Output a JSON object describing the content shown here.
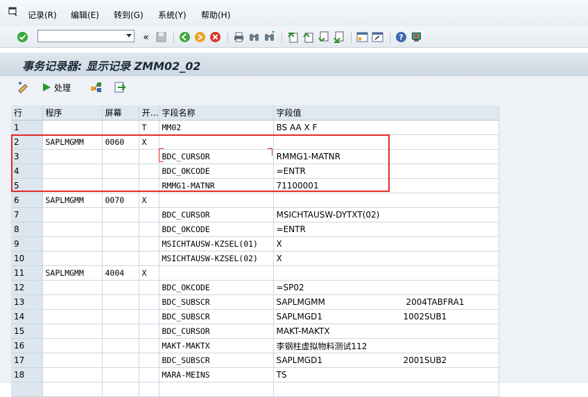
{
  "menu": [
    {
      "label": "记录(R)"
    },
    {
      "label": "编辑(E)"
    },
    {
      "label": "转到(G)"
    },
    {
      "label": "系统(Y)"
    },
    {
      "label": "帮助(H)"
    }
  ],
  "command_field": {
    "value": ""
  },
  "title": "事务记录器: 显示记录 ZMM02_02",
  "app_toolbar": {
    "process_label": "处理"
  },
  "table": {
    "headers": [
      "行",
      "程序",
      "屏幕",
      "开…",
      "字段名称",
      "字段值"
    ],
    "rows": [
      {
        "no": "1",
        "program": "",
        "screen": "",
        "start": "T",
        "field": "MM02",
        "value": "BS AA X   F",
        "value2": ""
      },
      {
        "no": "2",
        "program": "SAPLMGMM",
        "screen": "0060",
        "start": "X",
        "field": "",
        "value": "",
        "value2": ""
      },
      {
        "no": "3",
        "program": "",
        "screen": "",
        "start": "",
        "field": "BDC_CURSOR",
        "value": "RMMG1-MATNR",
        "value2": ""
      },
      {
        "no": "4",
        "program": "",
        "screen": "",
        "start": "",
        "field": "BDC_OKCODE",
        "value": "=ENTR",
        "value2": ""
      },
      {
        "no": "5",
        "program": "",
        "screen": "",
        "start": "",
        "field": "RMMG1-MATNR",
        "value": "71100001",
        "value2": ""
      },
      {
        "no": "6",
        "program": "SAPLMGMM",
        "screen": "0070",
        "start": "X",
        "field": "",
        "value": "",
        "value2": ""
      },
      {
        "no": "7",
        "program": "",
        "screen": "",
        "start": "",
        "field": "BDC_CURSOR",
        "value": "MSICHTAUSW-DYTXT(02)",
        "value2": ""
      },
      {
        "no": "8",
        "program": "",
        "screen": "",
        "start": "",
        "field": "BDC_OKCODE",
        "value": "=ENTR",
        "value2": ""
      },
      {
        "no": "9",
        "program": "",
        "screen": "",
        "start": "",
        "field": "MSICHTAUSW-KZSEL(01)",
        "value": "X",
        "value2": ""
      },
      {
        "no": "10",
        "program": "",
        "screen": "",
        "start": "",
        "field": "MSICHTAUSW-KZSEL(02)",
        "value": "X",
        "value2": ""
      },
      {
        "no": "11",
        "program": "SAPLMGMM",
        "screen": "4004",
        "start": "X",
        "field": "",
        "value": "",
        "value2": ""
      },
      {
        "no": "12",
        "program": "",
        "screen": "",
        "start": "",
        "field": "BDC_OKCODE",
        "value": "=SP02",
        "value2": ""
      },
      {
        "no": "13",
        "program": "",
        "screen": "",
        "start": "",
        "field": "BDC_SUBSCR",
        "value": "SAPLMGMM",
        "value2": "2004TABFRA1"
      },
      {
        "no": "14",
        "program": "",
        "screen": "",
        "start": "",
        "field": "BDC_SUBSCR",
        "value": "SAPLMGD1",
        "value2": "1002SUB1"
      },
      {
        "no": "15",
        "program": "",
        "screen": "",
        "start": "",
        "field": "BDC_CURSOR",
        "value": "MAKT-MAKTX",
        "value2": ""
      },
      {
        "no": "16",
        "program": "",
        "screen": "",
        "start": "",
        "field": "MAKT-MAKTX",
        "value": "李钢柱虚拟物料测试112",
        "value2": ""
      },
      {
        "no": "17",
        "program": "",
        "screen": "",
        "start": "",
        "field": "BDC_SUBSCR",
        "value": "SAPLMGD1",
        "value2": "2001SUB2"
      },
      {
        "no": "18",
        "program": "",
        "screen": "",
        "start": "",
        "field": "MARA-MEINS",
        "value": "TS",
        "value2": ""
      },
      {
        "no": "",
        "program": "",
        "screen": "",
        "start": "",
        "field": "",
        "value": "",
        "value2": ""
      }
    ]
  },
  "colors": {
    "highlight_border": "#e02828",
    "title_bg": "#cdd7e1",
    "grid_header": "#dfe7ef"
  },
  "icons": [
    "window-icon",
    "check-icon",
    "back-icon",
    "save-icon",
    "green-back-icon",
    "exit-icon",
    "cancel-icon",
    "print-icon",
    "find-icon",
    "find-next-icon",
    "first-page-icon",
    "prev-page-icon",
    "next-page-icon",
    "last-page-icon",
    "new-session-icon",
    "shortcut-icon",
    "help-icon",
    "customize-icon",
    "edit-icon",
    "execute-icon",
    "tree-icon",
    "export-icon"
  ]
}
